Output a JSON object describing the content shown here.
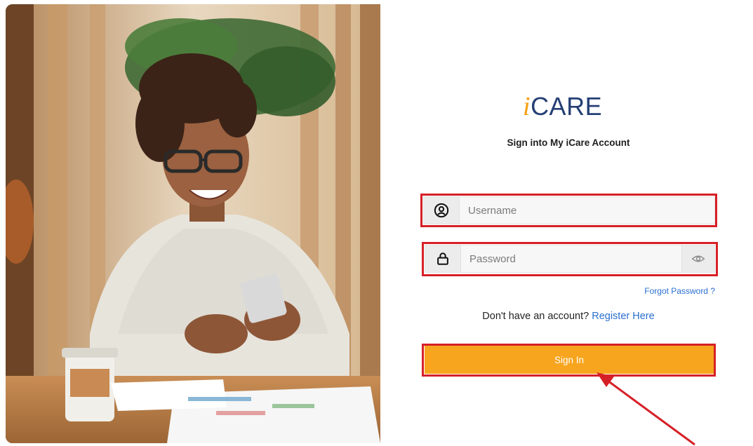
{
  "brand": {
    "logo_prefix": "i",
    "logo_main": "CARE",
    "accent_color": "#f5a014",
    "brand_color": "#253f74"
  },
  "login": {
    "subtitle": "Sign into My iCare Account",
    "username_placeholder": "Username",
    "password_placeholder": "Password",
    "forgot_label": "Forgot Password ?",
    "no_account_text": "Don't have an account?",
    "register_label": "Register Here",
    "signin_label": "Sign In",
    "signin_color": "#f7a51f",
    "highlight_color": "#d62027"
  },
  "icons": {
    "username": "user-circle-icon",
    "password": "lock-icon",
    "toggle": "eye-icon"
  }
}
